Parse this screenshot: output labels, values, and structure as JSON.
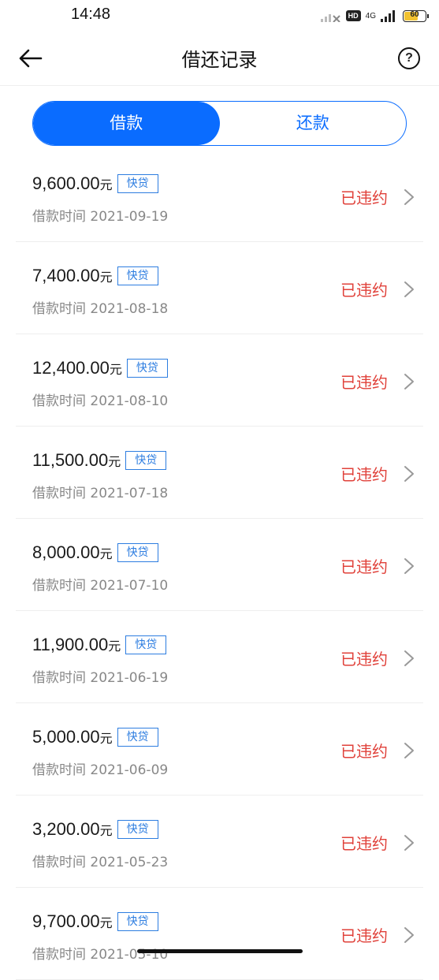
{
  "status_bar": {
    "time": "14:48",
    "hd": "HD",
    "network": "4G",
    "battery": "60",
    "battery_level": 0.6
  },
  "nav": {
    "title": "借还记录",
    "help": "?"
  },
  "tabs": [
    {
      "label": "借款",
      "active": true
    },
    {
      "label": "还款",
      "active": false
    }
  ],
  "records": [
    {
      "amount": "9,600.00",
      "unit": "元",
      "tag": "快贷",
      "date": "借款时间 2021-09-19",
      "status": "已违约"
    },
    {
      "amount": "7,400.00",
      "unit": "元",
      "tag": "快贷",
      "date": "借款时间 2021-08-18",
      "status": "已违约"
    },
    {
      "amount": "12,400.00",
      "unit": "元",
      "tag": "快贷",
      "date": "借款时间 2021-08-10",
      "status": "已违约"
    },
    {
      "amount": "11,500.00",
      "unit": "元",
      "tag": "快贷",
      "date": "借款时间 2021-07-18",
      "status": "已违约"
    },
    {
      "amount": "8,000.00",
      "unit": "元",
      "tag": "快贷",
      "date": "借款时间 2021-07-10",
      "status": "已违约"
    },
    {
      "amount": "11,900.00",
      "unit": "元",
      "tag": "快贷",
      "date": "借款时间 2021-06-19",
      "status": "已违约"
    },
    {
      "amount": "5,000.00",
      "unit": "元",
      "tag": "快贷",
      "date": "借款时间 2021-06-09",
      "status": "已违约"
    },
    {
      "amount": "3,200.00",
      "unit": "元",
      "tag": "快贷",
      "date": "借款时间 2021-05-23",
      "status": "已违约"
    },
    {
      "amount": "9,700.00",
      "unit": "元",
      "tag": "快贷",
      "date": "借款时间 2021-05-10",
      "status": "已违约"
    }
  ],
  "colors": {
    "accent": "#0a6cff",
    "tag": "#2d7de0",
    "status_red": "#e0413a"
  }
}
